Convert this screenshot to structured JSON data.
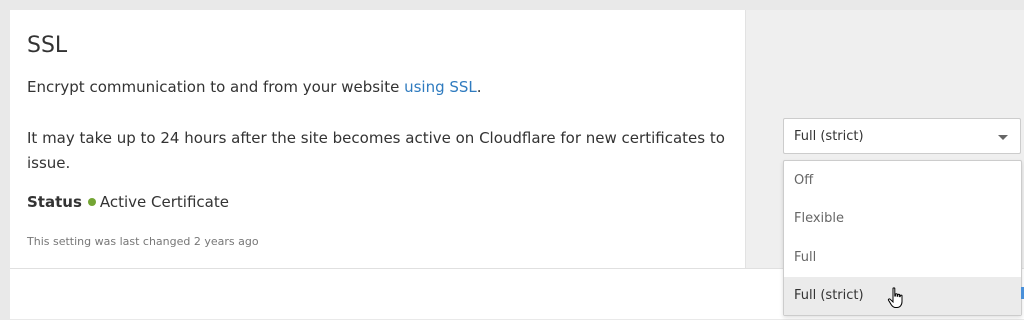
{
  "card": {
    "title": "SSL",
    "description_prefix": "Encrypt communication to and from your website ",
    "description_link": "using SSL",
    "description_suffix": ".",
    "note": "It may take up to 24 hours after the site becomes active on Cloudflare for new certificates to issue.",
    "status_label": "Status",
    "status_value": "Active Certificate",
    "status_color": "#74a534",
    "last_changed": "This setting was last changed 2 years ago"
  },
  "ssl_select": {
    "selected": "Full (strict)",
    "options": [
      "Off",
      "Flexible",
      "Full",
      "Full (strict)"
    ],
    "highlighted_option": "Full (strict)"
  },
  "colors": {
    "link": "#2f7bbf",
    "highlight": "#ebebeb"
  }
}
